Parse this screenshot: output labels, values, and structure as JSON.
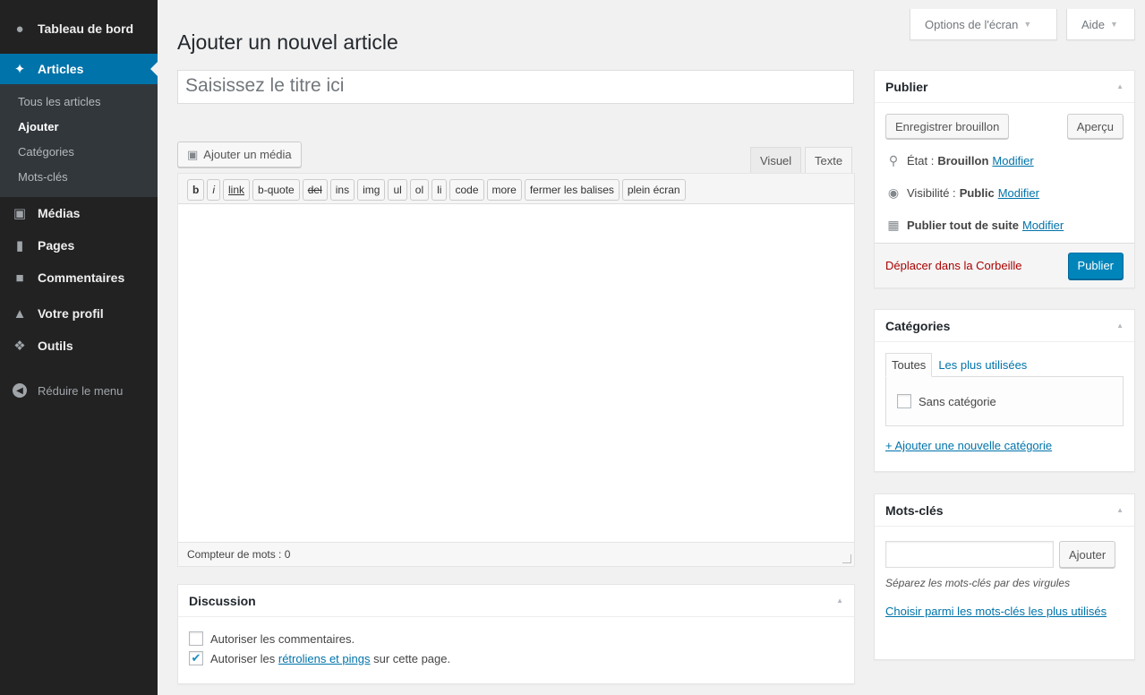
{
  "sidebar": {
    "dashboard": "Tableau de bord",
    "articles": "Articles",
    "submenu": [
      "Tous les articles",
      "Ajouter",
      "Catégories",
      "Mots-clés"
    ],
    "media": "Médias",
    "pages": "Pages",
    "comments": "Commentaires",
    "profile": "Votre profil",
    "tools": "Outils",
    "collapse": "Réduire le menu"
  },
  "screen_meta": {
    "options": "Options de l'écran",
    "help": "Aide"
  },
  "page_title": "Ajouter un nouvel article",
  "title_input": {
    "placeholder": "Saisissez le titre ici"
  },
  "editor": {
    "add_media": "Ajouter un média",
    "tab_visual": "Visuel",
    "tab_text": "Texte",
    "quicktags": [
      "b",
      "i",
      "link",
      "b-quote",
      "del",
      "ins",
      "img",
      "ul",
      "ol",
      "li",
      "code",
      "more",
      "fermer les balises",
      "plein écran"
    ],
    "word_count": "Compteur de mots : 0"
  },
  "discussion": {
    "title": "Discussion",
    "allow_comments": "Autoriser les commentaires.",
    "allow_pings_prefix": "Autoriser les ",
    "allow_pings_link": "rétroliens et pings",
    "allow_pings_suffix": " sur cette page.",
    "allow_comments_checked": false,
    "allow_pings_checked": true
  },
  "publish": {
    "title": "Publier",
    "save_draft": "Enregistrer brouillon",
    "preview": "Aperçu",
    "status_label": "État :",
    "status_value": "Brouillon",
    "visibility_label": "Visibilité :",
    "visibility_value": "Public",
    "schedule_label": "Publier tout de suite",
    "edit_link": "Modifier",
    "trash": "Déplacer dans la Corbeille",
    "publish_button": "Publier"
  },
  "categories": {
    "title": "Catégories",
    "tab_all": "Toutes",
    "tab_popular": "Les plus utilisées",
    "items": [
      "Sans catégorie"
    ],
    "add_new": "+ Ajouter une nouvelle catégorie"
  },
  "tags": {
    "title": "Mots-clés",
    "add_button": "Ajouter",
    "hint": "Séparez les mots-clés par des virgules",
    "choose_link": "Choisir parmi les mots-clés les plus utilisés"
  },
  "colors": {
    "accent": "#0073aa",
    "sidebar": "#222222",
    "primary_button": "#0085ba",
    "trash": "#aa0000"
  }
}
